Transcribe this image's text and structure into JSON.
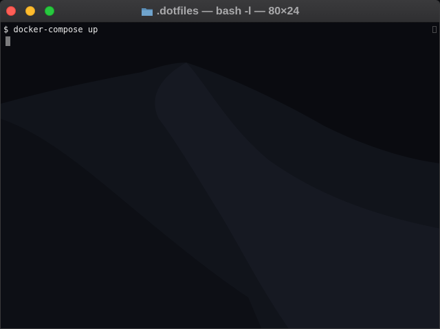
{
  "window": {
    "title": ".dotfiles — bash -l — 80×24"
  },
  "terminal": {
    "prompt": "$",
    "command": "docker-compose up"
  },
  "icons": {
    "folder": "folder-icon",
    "cursor": "cursor-block"
  },
  "colors": {
    "close": "#fe5f57",
    "minimize": "#febc2e",
    "zoom": "#28c840",
    "folder": "#5b8fb9"
  }
}
